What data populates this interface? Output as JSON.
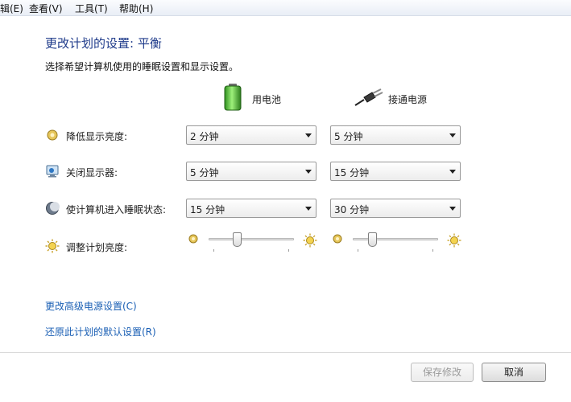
{
  "menubar": {
    "items": [
      {
        "label": "辑(E)"
      },
      {
        "label": "查看(V)"
      },
      {
        "label": "工具(T)"
      },
      {
        "label": "帮助(H)"
      }
    ]
  },
  "header": {
    "title": "更改计划的设置: 平衡",
    "subtitle": "选择希望计算机使用的睡眠设置和显示设置。"
  },
  "columns": {
    "battery_label": "用电池",
    "plugged_label": "接通电源"
  },
  "rows": [
    {
      "label": "降低显示亮度:",
      "battery": "2 分钟",
      "plugged": "5 分钟"
    },
    {
      "label": "关闭显示器:",
      "battery": "5 分钟",
      "plugged": "15 分钟"
    },
    {
      "label": "使计算机进入睡眠状态:",
      "battery": "15 分钟",
      "plugged": "30 分钟"
    }
  ],
  "brightness": {
    "label": "调整计划亮度:",
    "battery_level": 0.32,
    "plugged_level": 0.2
  },
  "links": {
    "advanced": "更改高级电源设置(C)",
    "restore": "还原此计划的默认设置(R)"
  },
  "buttons": {
    "save": "保存修改",
    "cancel": "取消"
  }
}
